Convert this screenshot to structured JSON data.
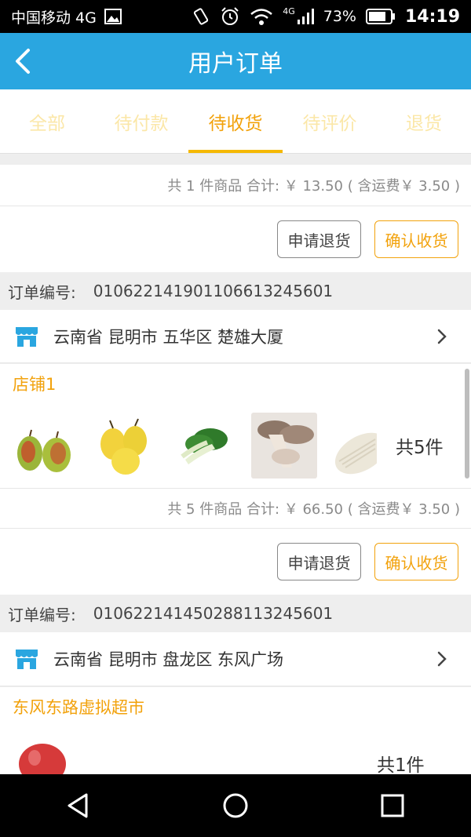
{
  "status_bar": {
    "carrier": "中国移动 4G",
    "battery": "73%",
    "time": "14:19",
    "net": "4G"
  },
  "header": {
    "title": "用户订单"
  },
  "tabs": [
    {
      "label": "全部",
      "active": false
    },
    {
      "label": "待付款",
      "active": false
    },
    {
      "label": "待收货",
      "active": true
    },
    {
      "label": "待评价",
      "active": false
    },
    {
      "label": "退货",
      "active": false
    }
  ],
  "orders": [
    {
      "summary": "共 1 件商品  合计:   ￥ 13.50 ( 含运费￥ 3.50 )",
      "return_label": "申请退货",
      "confirm_label": "确认收货"
    },
    {
      "order_no_label": "订单编号:",
      "order_no": "010622141901106613245601",
      "address": "云南省 昆明市 五华区 楚雄大厦",
      "store": "店铺1",
      "count": "共5件",
      "summary": "共 5 件商品  合计:   ￥ 66.50 ( 含运费￥ 3.50 )",
      "return_label": "申请退货",
      "confirm_label": "确认收货"
    },
    {
      "order_no_label": "订单编号:",
      "order_no": "010622141450288113245601",
      "address": "云南省 昆明市 盘龙区 东风广场",
      "store": "东风东路虚拟超市",
      "count": "共1件"
    }
  ],
  "colors": {
    "header": "#2aa6e0",
    "accent": "#f2a20c",
    "tab_inactive": "#fbe7a8"
  }
}
